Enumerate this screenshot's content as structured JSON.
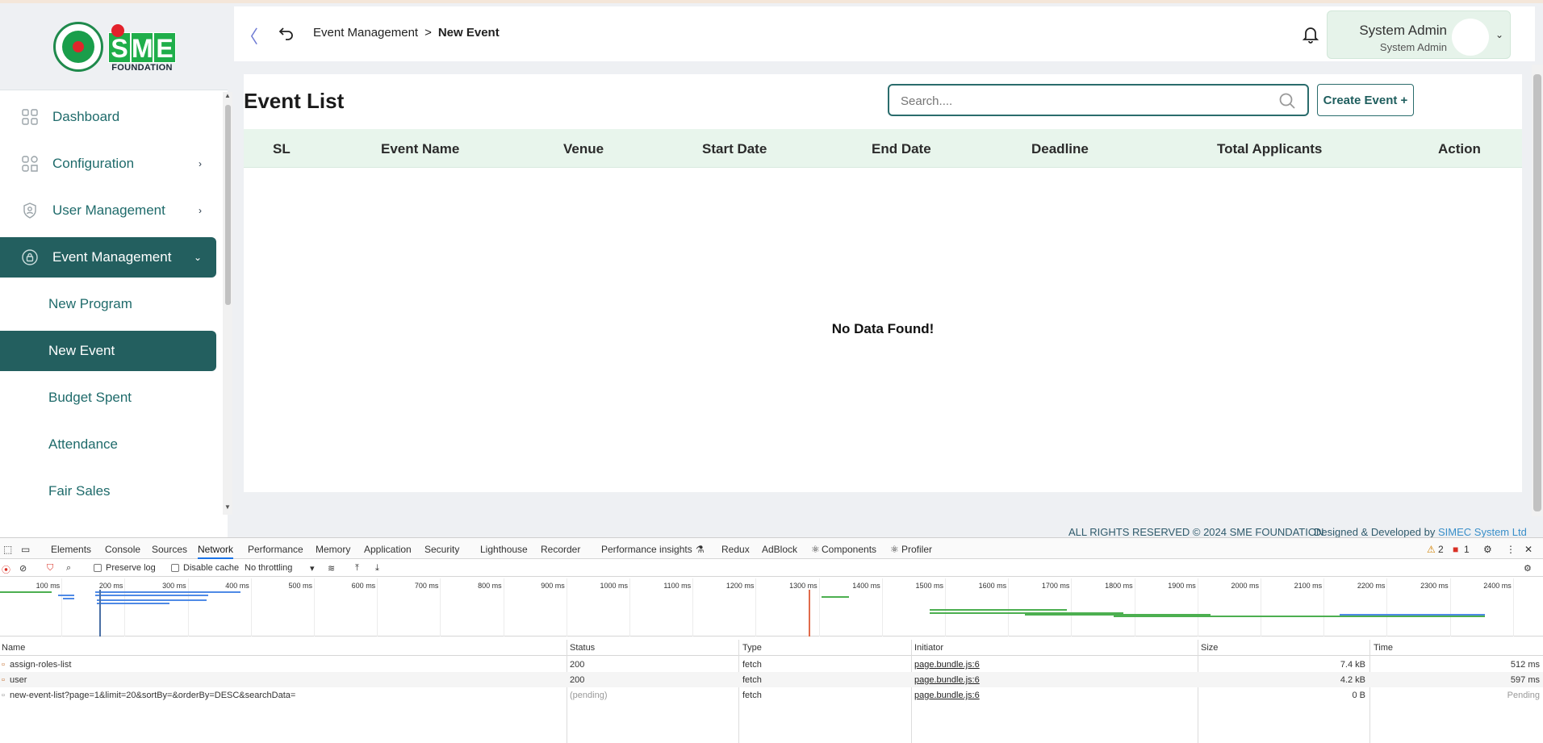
{
  "header": {
    "breadcrumb": {
      "parent": "Event Management",
      "separator": ">",
      "current": "New Event"
    },
    "user_name": "System Admin",
    "user_role": "System Admin"
  },
  "logo": {
    "letters": [
      "S",
      "M",
      "E"
    ],
    "foundation": "FOUNDATION"
  },
  "sidebar": {
    "items": [
      {
        "label": "Dashboard",
        "icon": "grid-icon",
        "has_children": false
      },
      {
        "label": "Configuration",
        "icon": "config-icon",
        "has_children": true,
        "chevron": "›"
      },
      {
        "label": "User Management",
        "icon": "shield-user-icon",
        "has_children": true,
        "chevron": "›"
      },
      {
        "label": "Event Management",
        "icon": "lock-shield-icon",
        "has_children": true,
        "chevron": "⌄",
        "active": true
      }
    ],
    "sub_items": [
      {
        "label": "New Program"
      },
      {
        "label": "New Event",
        "active": true
      },
      {
        "label": "Budget Spent"
      },
      {
        "label": "Attendance"
      },
      {
        "label": "Fair Sales"
      }
    ]
  },
  "main": {
    "title": "Event List",
    "search": {
      "placeholder": "Search...."
    },
    "create_button": "Create Event +",
    "table": {
      "columns": [
        "SL",
        "Event Name",
        "Venue",
        "Start Date",
        "End Date",
        "Deadline",
        "Total Applicants",
        "Action"
      ],
      "empty_message": "No Data Found!"
    }
  },
  "footer": {
    "copyright": "ALL RIGHTS RESERVED © 2024 SME FOUNDATION",
    "designed_by": "Designed & Developed by",
    "developer": "SIMEC System Ltd"
  },
  "devtools": {
    "tabs": [
      "Elements",
      "Console",
      "Sources",
      "Network",
      "Performance",
      "Memory",
      "Application",
      "Security",
      "Lighthouse",
      "Recorder",
      "Performance insights",
      "Redux",
      "AdBlock",
      "Components",
      "Profiler"
    ],
    "active_tab": "Network",
    "warnings": "2",
    "errors": "1",
    "toolbar": {
      "preserve_log": "Preserve log",
      "disable_cache": "Disable cache",
      "throttling": "No throttling"
    },
    "timeline_ticks": [
      "100 ms",
      "200 ms",
      "300 ms",
      "400 ms",
      "500 ms",
      "600 ms",
      "700 ms",
      "800 ms",
      "900 ms",
      "1000 ms",
      "1100 ms",
      "1200 ms",
      "1300 ms",
      "1400 ms",
      "1500 ms",
      "1600 ms",
      "1700 ms",
      "1800 ms",
      "1900 ms",
      "2000 ms",
      "2100 ms",
      "2200 ms",
      "2300 ms",
      "2400 ms"
    ],
    "columns": [
      "Name",
      "Status",
      "Type",
      "Initiator",
      "Size",
      "Time"
    ],
    "rows": [
      {
        "name": "assign-roles-list",
        "status": "200",
        "type": "fetch",
        "initiator": "page.bundle.js:6",
        "size": "7.4 kB",
        "time": "512 ms"
      },
      {
        "name": "user",
        "status": "200",
        "type": "fetch",
        "initiator": "page.bundle.js:6",
        "size": "4.2 kB",
        "time": "597 ms"
      },
      {
        "name": "new-event-list?page=1&limit=20&sortBy=&orderBy=DESC&searchData=",
        "status": "(pending)",
        "type": "fetch",
        "initiator": "page.bundle.js:6",
        "size": "0 B",
        "time": "Pending"
      }
    ]
  }
}
